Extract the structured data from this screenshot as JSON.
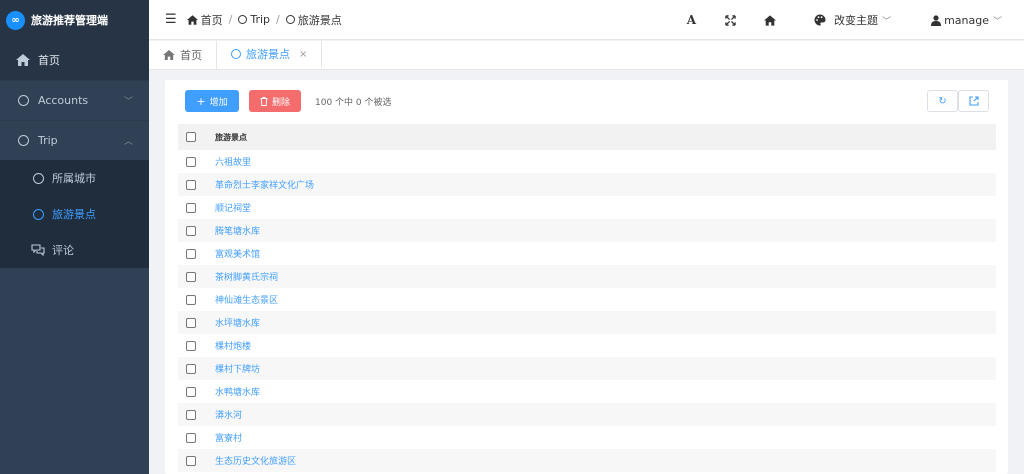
{
  "app": {
    "title": "旅游推荐管理端",
    "logo_glyph": "∞",
    "accent": "#409eff"
  },
  "sidebar": {
    "home_label": "首页",
    "accounts_label": "Accounts",
    "trip_label": "Trip",
    "trip_children": [
      {
        "label": "所属城市",
        "icon": "city-icon"
      },
      {
        "label": "旅游景点",
        "icon": "circle-icon",
        "active": true
      },
      {
        "label": "评论",
        "icon": "comments-icon"
      }
    ]
  },
  "header": {
    "breadcrumb": [
      "首页",
      "Trip",
      "旅游景点"
    ],
    "change_theme": "改变主题",
    "user": "manage",
    "font_btn": "A"
  },
  "tabs": [
    {
      "label": "首页",
      "close": ""
    },
    {
      "label": "旅游景点",
      "close": "×"
    }
  ],
  "toolbar": {
    "add_label": "增加",
    "delete_label": "删除",
    "selection_text": "100 个中 0 个被选"
  },
  "table": {
    "column_header": "旅游景点",
    "rows": [
      "六祖故里",
      "革命烈士李家祥文化广场",
      "顺记祠堂",
      "腾笔塘水库",
      "富观美术馆",
      "茶树脚黄氏宗祠",
      "神仙滩生态景区",
      "水坪塘水库",
      "棵村炮楼",
      "棵村下牌坊",
      "水鸭塘水库",
      "漭水河",
      "富寮村",
      "生态历史文化旅游区"
    ]
  }
}
